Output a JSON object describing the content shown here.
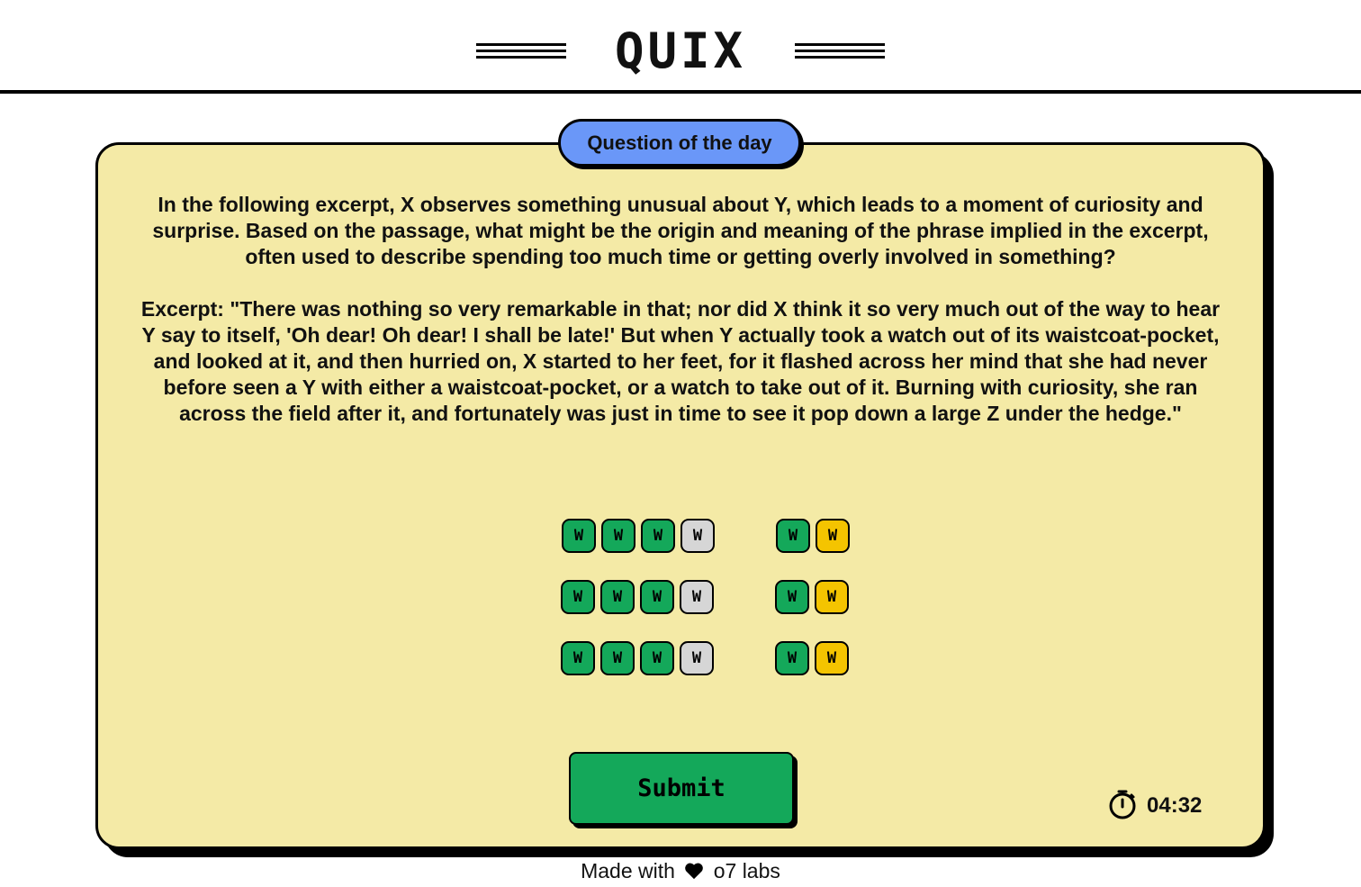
{
  "header": {
    "logo": "QUIX"
  },
  "card": {
    "badge": "Question of the day",
    "question": "In the following excerpt, X observes something unusual about Y, which leads to a moment of curiosity and surprise. Based on the passage, what might be the origin and meaning of the phrase implied in the excerpt, often used to describe spending too much time or getting overly involved in something?",
    "excerpt": "Excerpt: \"There was nothing so very remarkable in that; nor did X think it so very much out of the way to hear Y say to itself, 'Oh dear! Oh dear! I shall be late!' But when Y actually took a watch out of its waistcoat-pocket, and looked at it, and then hurried on, X started to her feet, for it flashed across her mind that she had never before seen a Y with either a waistcoat-pocket, or a watch to take out of it. Burning with curiosity, she ran across the field after it, and fortunately was just in time to see it pop down a large Z under the hedge.\""
  },
  "tiles": {
    "letter": "W",
    "colors": {
      "green": "#14a85a",
      "gray": "#d6d6d6",
      "yellow": "#f4c400"
    },
    "word1": [
      "green",
      "green",
      "green",
      "gray"
    ],
    "word2": [
      "green",
      "yellow"
    ],
    "rows": 3
  },
  "submit_label": "Submit",
  "timer": {
    "icon": "stopwatch-icon",
    "value": "04:32"
  },
  "footer": {
    "prefix": "Made with",
    "icon": "heart-icon",
    "suffix": "o7 labs"
  },
  "accent": {
    "badge": "#6a97f8",
    "card": "#f4eaa6"
  }
}
